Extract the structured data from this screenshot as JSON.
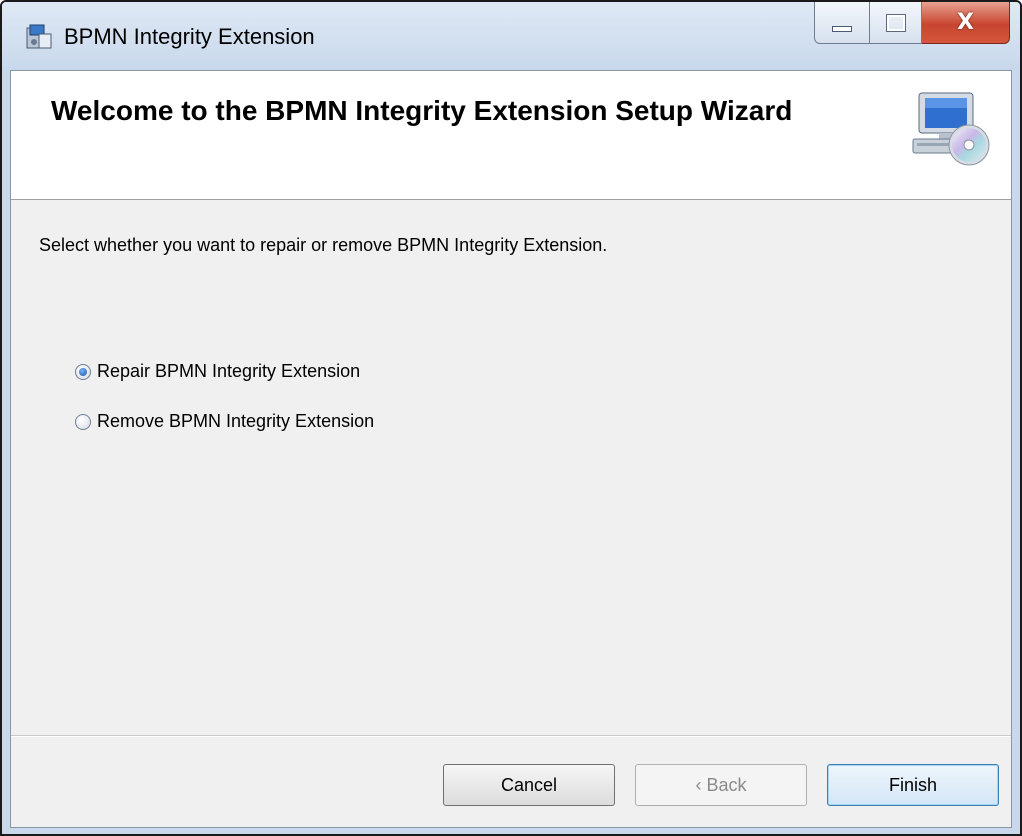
{
  "window": {
    "title": "BPMN Integrity Extension",
    "icons": {
      "app": "installer-package-icon",
      "banner": "computer-cd-icon"
    }
  },
  "banner": {
    "title": "Welcome to the BPMN Integrity Extension Setup Wizard"
  },
  "body": {
    "instruction": "Select whether you want to repair or remove BPMN Integrity Extension.",
    "options": [
      {
        "label": "Repair BPMN Integrity Extension",
        "selected": true
      },
      {
        "label": "Remove BPMN Integrity Extension",
        "selected": false
      }
    ]
  },
  "buttons": {
    "cancel": "Cancel",
    "back": "‹ Back",
    "finish": "Finish"
  },
  "colors": {
    "close_button": "#c8452f",
    "default_button_border": "#3c7fb1"
  }
}
